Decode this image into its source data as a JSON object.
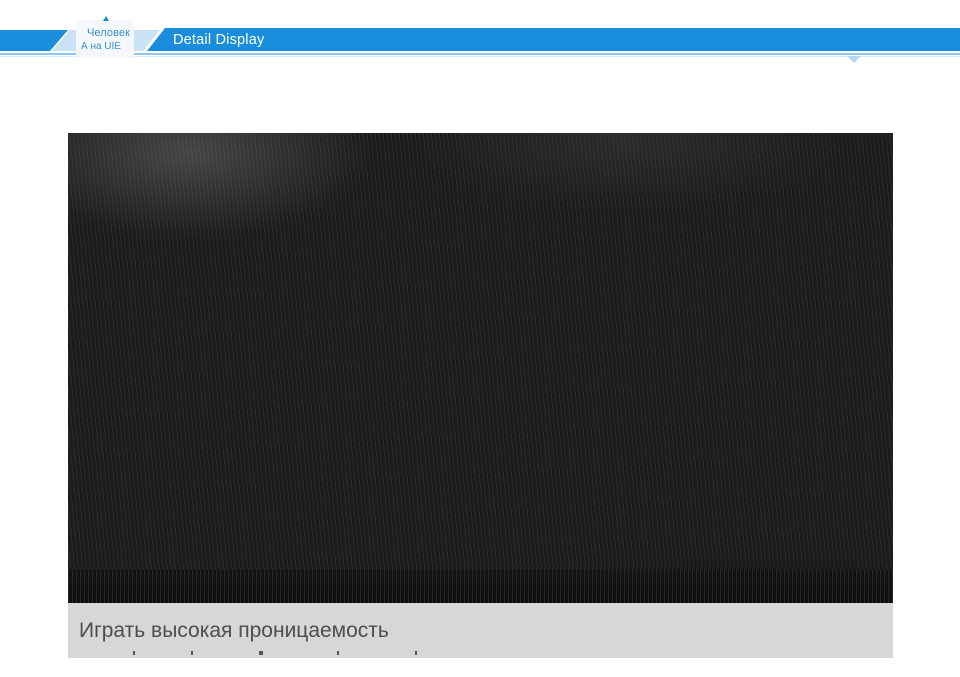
{
  "header": {
    "badge_line1": "Человек",
    "badge_line2": "А на UIE",
    "title": "Detail  Display"
  },
  "photo": {
    "caption": "Играть высокая проницаемость"
  },
  "colors": {
    "banner_blue": "#1a8ddd",
    "banner_light": "#6fb9ee",
    "caption_bg": "#d7d7d7",
    "fabric": "#1f1f1f"
  }
}
